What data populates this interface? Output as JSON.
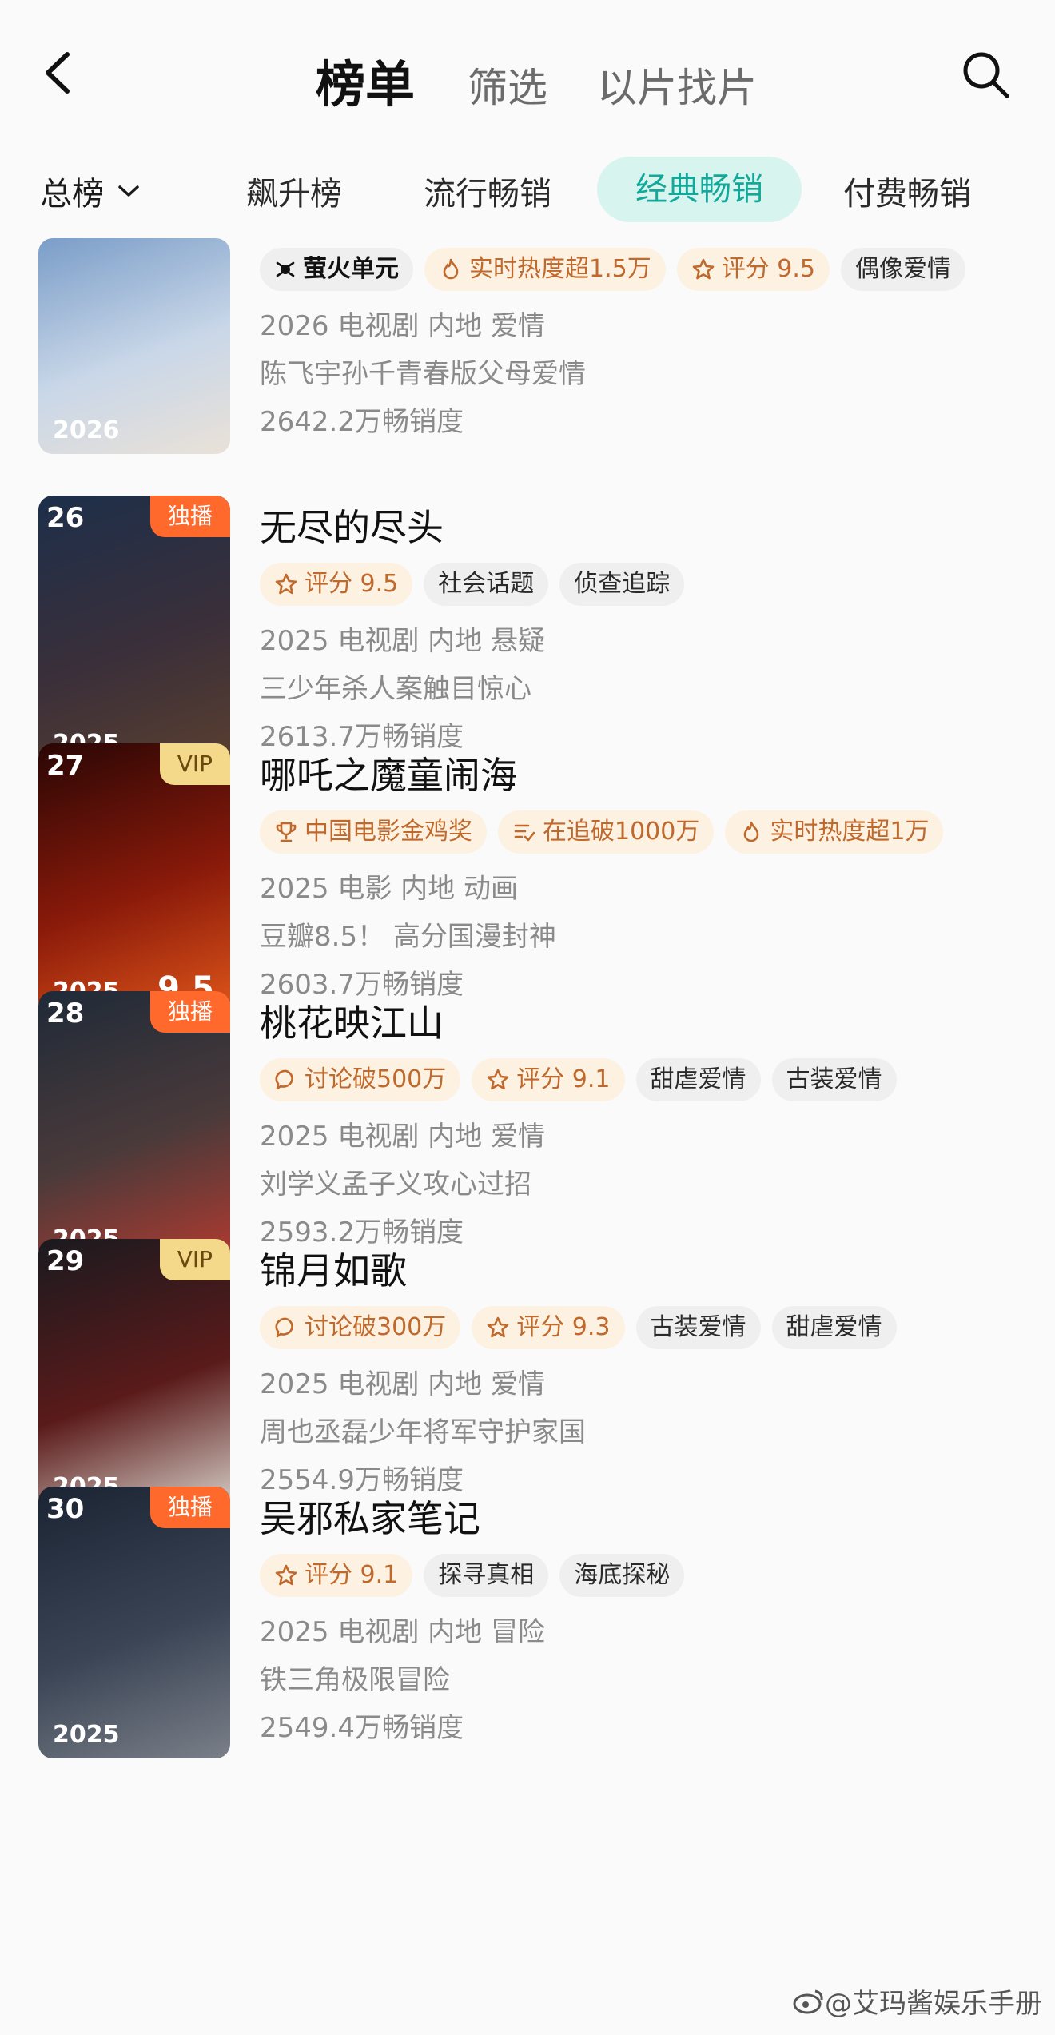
{
  "nav": {
    "tabs": [
      "榜单",
      "筛选",
      "以片找片"
    ],
    "active_index": 0
  },
  "subtabs": {
    "all_label": "总榜",
    "items": [
      "飙升榜",
      "流行畅销",
      "经典畅销",
      "付费畅销"
    ],
    "active_index": 2
  },
  "colors": {
    "accent": "#13a89a",
    "accent_bg": "#d8f4ef",
    "highlight_tag": "#c0692c",
    "exclusive": "#ff6a2c",
    "vip": "#f5d98a"
  },
  "items": [
    {
      "rank": "",
      "badge": "",
      "year": "2026",
      "score": "",
      "title": "",
      "tags": [
        {
          "icon": "firefly-brand-icon",
          "text": "萤火单元",
          "style": "brand"
        },
        {
          "icon": "flame-icon",
          "text": "实时热度超1.5万",
          "style": "hl"
        },
        {
          "icon": "star-icon",
          "text": "评分 9.5",
          "style": "hl"
        },
        {
          "icon": "",
          "text": "偶像爱情",
          "style": "pl"
        }
      ],
      "line1": "2026 电视剧 内地 爱情",
      "line2": "陈飞宇孙千青春版父母爱情",
      "line3": "2642.2万畅销度",
      "poster_colors": [
        "#7a9dc8",
        "#c9d7e8",
        "#e9e1d8"
      ]
    },
    {
      "rank": "26",
      "badge": "独播",
      "year": "2025",
      "score": "",
      "title": "无尽的尽头",
      "tags": [
        {
          "icon": "star-icon",
          "text": "评分 9.5",
          "style": "hl"
        },
        {
          "icon": "",
          "text": "社会话题",
          "style": "pl"
        },
        {
          "icon": "",
          "text": "侦查追踪",
          "style": "pl"
        }
      ],
      "line1": "2025 电视剧 内地 悬疑",
      "line2": "三少年杀人案触目惊心",
      "line3": "2613.7万畅销度",
      "poster_colors": [
        "#1d2f4a",
        "#3a2f3a",
        "#5a3f2f"
      ]
    },
    {
      "rank": "27",
      "badge": "VIP",
      "year": "2025",
      "score": "9.5",
      "title": "哪吒之魔童闹海",
      "tags": [
        {
          "icon": "trophy-icon",
          "text": "中国电影金鸡奖",
          "style": "hl"
        },
        {
          "icon": "list-icon",
          "text": "在追破1000万",
          "style": "hl"
        },
        {
          "icon": "flame-icon",
          "text": "实时热度超1万",
          "style": "hl"
        }
      ],
      "line1": "2025 电影 内地 动画",
      "line2": "豆瓣8.5！ 高分国漫封神",
      "line3": "2603.7万畅销度",
      "poster_colors": [
        "#2a0605",
        "#8a1a0a",
        "#e0561a"
      ]
    },
    {
      "rank": "28",
      "badge": "独播",
      "year": "2025",
      "score": "",
      "title": "桃花映江山",
      "tags": [
        {
          "icon": "chat-icon",
          "text": "讨论破500万",
          "style": "hl"
        },
        {
          "icon": "star-icon",
          "text": "评分 9.1",
          "style": "hl"
        },
        {
          "icon": "",
          "text": "甜虐爱情",
          "style": "pl"
        },
        {
          "icon": "",
          "text": "古装爱情",
          "style": "pl"
        }
      ],
      "line1": "2025 电视剧 内地 爱情",
      "line2": "刘学义孟子义攻心过招",
      "line3": "2593.2万畅销度",
      "poster_colors": [
        "#1f2a38",
        "#4a3a3a",
        "#b23a30"
      ]
    },
    {
      "rank": "29",
      "badge": "VIP",
      "year": "2025",
      "score": "",
      "title": "锦月如歌",
      "tags": [
        {
          "icon": "chat-icon",
          "text": "讨论破300万",
          "style": "hl"
        },
        {
          "icon": "star-icon",
          "text": "评分 9.3",
          "style": "hl"
        },
        {
          "icon": "",
          "text": "古装爱情",
          "style": "pl"
        },
        {
          "icon": "",
          "text": "甜虐爱情",
          "style": "pl"
        }
      ],
      "line1": "2025 电视剧 内地 爱情",
      "line2": "周也丞磊少年将军守护家国",
      "line3": "2554.9万畅销度",
      "poster_colors": [
        "#1a1a1f",
        "#5a1a1a",
        "#d8d0c8"
      ]
    },
    {
      "rank": "30",
      "badge": "独播",
      "year": "2025",
      "score": "",
      "title": "吴邪私家笔记",
      "tags": [
        {
          "icon": "star-icon",
          "text": "评分 9.1",
          "style": "hl"
        },
        {
          "icon": "",
          "text": "探寻真相",
          "style": "pl"
        },
        {
          "icon": "",
          "text": "海底探秘",
          "style": "pl"
        }
      ],
      "line1": "2025 电视剧 内地 冒险",
      "line2": "铁三角极限冒险",
      "line3": "2549.4万畅销度",
      "poster_colors": [
        "#1a2433",
        "#3a4455",
        "#7a7f88"
      ]
    }
  ],
  "watermark": "@艾玛酱娱乐手册"
}
